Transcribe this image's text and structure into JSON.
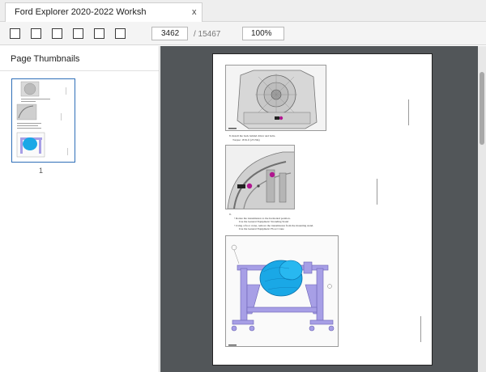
{
  "tab": {
    "title": "Ford Explorer 2020-2022 Worksh",
    "close": "x"
  },
  "toolbar": {
    "page_number": "3462",
    "page_total": "/ 15467",
    "zoom": "100%"
  },
  "sidebar": {
    "title": "Page Thumbnails",
    "thumb_label": "1"
  },
  "document": {
    "step_1": "8.   Install the back behind driver and bolts.",
    "step_1_torque": "Torque: 18 lb.ft (25 Nm)",
    "step_2": "9.",
    "bullet_1": "•   Rotate the transmission to the horizontal position.",
    "bullet_1_sub": "Use the General Equipment: Stranding Stand",
    "bullet_2": "•   Using a floor crane, remove the transmission from the mounting stand.",
    "bullet_2_sub": "Use the General Equipment: Floor Crane"
  },
  "colors": {
    "viewer_bg": "#525659",
    "selection": "#2f6fb8",
    "magenta": "#b0158f",
    "cyan": "#1aa8e6",
    "lavender": "#a79fe6"
  }
}
